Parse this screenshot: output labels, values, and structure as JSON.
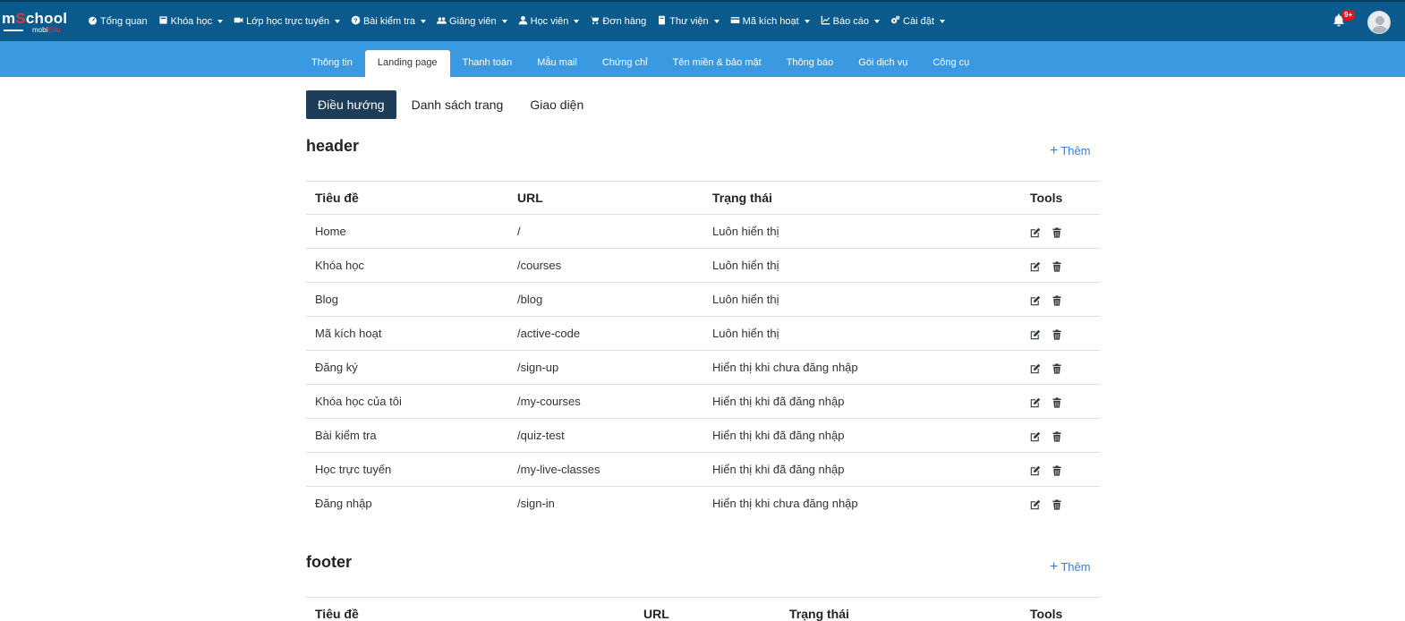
{
  "brand": {
    "logo_main_pre": "m",
    "logo_main_accent": "S",
    "logo_main_post": "chool",
    "logo_sub_pre": "mobi",
    "logo_sub_accent": "Edu"
  },
  "topnav": [
    {
      "label": "Tổng quan",
      "icon": "dashboard-icon",
      "dropdown": false
    },
    {
      "label": "Khóa học",
      "icon": "book-icon",
      "dropdown": true
    },
    {
      "label": "Lớp học trực tuyến",
      "icon": "video-icon",
      "dropdown": true
    },
    {
      "label": "Bài kiểm tra",
      "icon": "question-circle-icon",
      "dropdown": true
    },
    {
      "label": "Giảng viên",
      "icon": "users-icon",
      "dropdown": true
    },
    {
      "label": "Học viên",
      "icon": "user-icon",
      "dropdown": true
    },
    {
      "label": "Đơn hàng",
      "icon": "cart-icon",
      "dropdown": false
    },
    {
      "label": "Thư viện",
      "icon": "library-icon",
      "dropdown": true
    },
    {
      "label": "Mã kích hoạt",
      "icon": "card-icon",
      "dropdown": true
    },
    {
      "label": "Báo cáo",
      "icon": "chart-icon",
      "dropdown": true
    },
    {
      "label": "Cài đặt",
      "icon": "gears-icon",
      "dropdown": true
    }
  ],
  "notifications": {
    "badge": "9+"
  },
  "subtabs": [
    {
      "label": "Thông tin",
      "active": false
    },
    {
      "label": "Landing page",
      "active": true
    },
    {
      "label": "Thanh toán",
      "active": false
    },
    {
      "label": "Mẫu mail",
      "active": false
    },
    {
      "label": "Chứng chỉ",
      "active": false
    },
    {
      "label": "Tên miền & bảo mật",
      "active": false
    },
    {
      "label": "Thông báo",
      "active": false
    },
    {
      "label": "Gói dịch vụ",
      "active": false
    },
    {
      "label": "Công cụ",
      "active": false
    }
  ],
  "pills": [
    {
      "label": "Điều hướng",
      "active": true
    },
    {
      "label": "Danh sách trang",
      "active": false
    },
    {
      "label": "Giao diện",
      "active": false
    }
  ],
  "header_section": {
    "title": "header",
    "add_label": "Thêm",
    "columns": [
      "Tiêu đề",
      "URL",
      "Trạng thái",
      "Tools"
    ],
    "rows": [
      {
        "title": "Home",
        "url": "/",
        "status": "Luôn hiển thị"
      },
      {
        "title": "Khóa học",
        "url": "/courses",
        "status": "Luôn hiển thị"
      },
      {
        "title": "Blog",
        "url": "/blog",
        "status": "Luôn hiển thị"
      },
      {
        "title": "Mã kích hoạt",
        "url": "/active-code",
        "status": "Luôn hiển thị"
      },
      {
        "title": "Đăng ký",
        "url": "/sign-up",
        "status": "Hiển thị khi chưa đăng nhập"
      },
      {
        "title": "Khóa học của tôi",
        "url": "/my-courses",
        "status": "Hiển thị khi đã đăng nhập"
      },
      {
        "title": "Bài kiểm tra",
        "url": "/quiz-test",
        "status": "Hiển thị khi đã đăng nhập"
      },
      {
        "title": "Học trực tuyến",
        "url": "/my-live-classes",
        "status": "Hiển thị khi đã đăng nhập"
      },
      {
        "title": "Đăng nhập",
        "url": "/sign-in",
        "status": "Hiển thị khi chưa đăng nhập"
      }
    ]
  },
  "footer_section": {
    "title": "footer",
    "add_label": "Thêm",
    "columns": [
      "Tiêu đề",
      "URL",
      "Trạng thái",
      "Tools"
    ]
  },
  "colors": {
    "topbar": "#0b5a8e",
    "subbar": "#3a9ae1",
    "pill_active": "#1e3d59",
    "link": "#2f80ed"
  }
}
